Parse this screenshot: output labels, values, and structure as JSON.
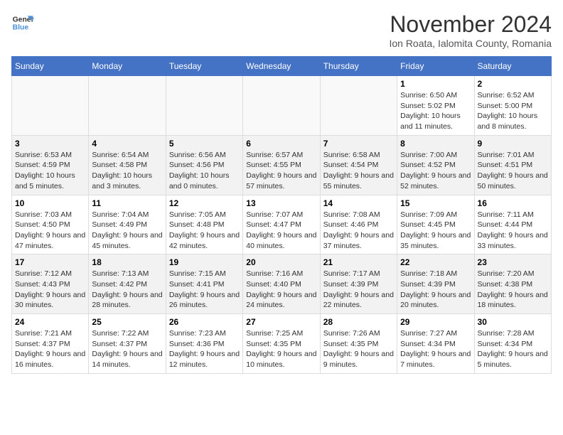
{
  "logo": {
    "line1": "General",
    "line2": "Blue"
  },
  "title": "November 2024",
  "subtitle": "Ion Roata, Ialomita County, Romania",
  "days_of_week": [
    "Sunday",
    "Monday",
    "Tuesday",
    "Wednesday",
    "Thursday",
    "Friday",
    "Saturday"
  ],
  "weeks": [
    [
      {
        "day": "",
        "info": ""
      },
      {
        "day": "",
        "info": ""
      },
      {
        "day": "",
        "info": ""
      },
      {
        "day": "",
        "info": ""
      },
      {
        "day": "",
        "info": ""
      },
      {
        "day": "1",
        "info": "Sunrise: 6:50 AM\nSunset: 5:02 PM\nDaylight: 10 hours and 11 minutes."
      },
      {
        "day": "2",
        "info": "Sunrise: 6:52 AM\nSunset: 5:00 PM\nDaylight: 10 hours and 8 minutes."
      }
    ],
    [
      {
        "day": "3",
        "info": "Sunrise: 6:53 AM\nSunset: 4:59 PM\nDaylight: 10 hours and 5 minutes."
      },
      {
        "day": "4",
        "info": "Sunrise: 6:54 AM\nSunset: 4:58 PM\nDaylight: 10 hours and 3 minutes."
      },
      {
        "day": "5",
        "info": "Sunrise: 6:56 AM\nSunset: 4:56 PM\nDaylight: 10 hours and 0 minutes."
      },
      {
        "day": "6",
        "info": "Sunrise: 6:57 AM\nSunset: 4:55 PM\nDaylight: 9 hours and 57 minutes."
      },
      {
        "day": "7",
        "info": "Sunrise: 6:58 AM\nSunset: 4:54 PM\nDaylight: 9 hours and 55 minutes."
      },
      {
        "day": "8",
        "info": "Sunrise: 7:00 AM\nSunset: 4:52 PM\nDaylight: 9 hours and 52 minutes."
      },
      {
        "day": "9",
        "info": "Sunrise: 7:01 AM\nSunset: 4:51 PM\nDaylight: 9 hours and 50 minutes."
      }
    ],
    [
      {
        "day": "10",
        "info": "Sunrise: 7:03 AM\nSunset: 4:50 PM\nDaylight: 9 hours and 47 minutes."
      },
      {
        "day": "11",
        "info": "Sunrise: 7:04 AM\nSunset: 4:49 PM\nDaylight: 9 hours and 45 minutes."
      },
      {
        "day": "12",
        "info": "Sunrise: 7:05 AM\nSunset: 4:48 PM\nDaylight: 9 hours and 42 minutes."
      },
      {
        "day": "13",
        "info": "Sunrise: 7:07 AM\nSunset: 4:47 PM\nDaylight: 9 hours and 40 minutes."
      },
      {
        "day": "14",
        "info": "Sunrise: 7:08 AM\nSunset: 4:46 PM\nDaylight: 9 hours and 37 minutes."
      },
      {
        "day": "15",
        "info": "Sunrise: 7:09 AM\nSunset: 4:45 PM\nDaylight: 9 hours and 35 minutes."
      },
      {
        "day": "16",
        "info": "Sunrise: 7:11 AM\nSunset: 4:44 PM\nDaylight: 9 hours and 33 minutes."
      }
    ],
    [
      {
        "day": "17",
        "info": "Sunrise: 7:12 AM\nSunset: 4:43 PM\nDaylight: 9 hours and 30 minutes."
      },
      {
        "day": "18",
        "info": "Sunrise: 7:13 AM\nSunset: 4:42 PM\nDaylight: 9 hours and 28 minutes."
      },
      {
        "day": "19",
        "info": "Sunrise: 7:15 AM\nSunset: 4:41 PM\nDaylight: 9 hours and 26 minutes."
      },
      {
        "day": "20",
        "info": "Sunrise: 7:16 AM\nSunset: 4:40 PM\nDaylight: 9 hours and 24 minutes."
      },
      {
        "day": "21",
        "info": "Sunrise: 7:17 AM\nSunset: 4:39 PM\nDaylight: 9 hours and 22 minutes."
      },
      {
        "day": "22",
        "info": "Sunrise: 7:18 AM\nSunset: 4:39 PM\nDaylight: 9 hours and 20 minutes."
      },
      {
        "day": "23",
        "info": "Sunrise: 7:20 AM\nSunset: 4:38 PM\nDaylight: 9 hours and 18 minutes."
      }
    ],
    [
      {
        "day": "24",
        "info": "Sunrise: 7:21 AM\nSunset: 4:37 PM\nDaylight: 9 hours and 16 minutes."
      },
      {
        "day": "25",
        "info": "Sunrise: 7:22 AM\nSunset: 4:37 PM\nDaylight: 9 hours and 14 minutes."
      },
      {
        "day": "26",
        "info": "Sunrise: 7:23 AM\nSunset: 4:36 PM\nDaylight: 9 hours and 12 minutes."
      },
      {
        "day": "27",
        "info": "Sunrise: 7:25 AM\nSunset: 4:35 PM\nDaylight: 9 hours and 10 minutes."
      },
      {
        "day": "28",
        "info": "Sunrise: 7:26 AM\nSunset: 4:35 PM\nDaylight: 9 hours and 9 minutes."
      },
      {
        "day": "29",
        "info": "Sunrise: 7:27 AM\nSunset: 4:34 PM\nDaylight: 9 hours and 7 minutes."
      },
      {
        "day": "30",
        "info": "Sunrise: 7:28 AM\nSunset: 4:34 PM\nDaylight: 9 hours and 5 minutes."
      }
    ]
  ]
}
